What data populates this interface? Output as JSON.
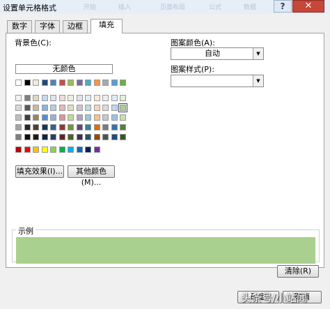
{
  "window": {
    "title": "设置单元格格式",
    "ghost_menu": [
      "开始",
      "插入",
      "页面布局",
      "公式",
      "数据"
    ],
    "help_label": "?",
    "close_label": "✕"
  },
  "tabs": [
    {
      "label": "数字",
      "active": false
    },
    {
      "label": "字体",
      "active": false
    },
    {
      "label": "边框",
      "active": false
    },
    {
      "label": "填充",
      "active": true
    }
  ],
  "fill": {
    "bg_color_label": "背景色(C):",
    "no_color_label": "无颜色",
    "palette_top": [
      "#ffffff",
      "#000000",
      "#eeece1",
      "#1f497d",
      "#4f81bd",
      "#c0504d",
      "#9bbb59",
      "#8064a2",
      "#4bacc6",
      "#f79646",
      "#aaaaaa",
      "#5b9bd5",
      "#70ad47"
    ],
    "palette_grid": [
      [
        "#f2f2f2",
        "#7f7f7f",
        "#ddd9c3",
        "#c6d9f0",
        "#dbe5f1",
        "#f2dcdb",
        "#ebf1dd",
        "#e5e0ec",
        "#dbeef3",
        "#fdeada",
        "#ededed",
        "#deebf6",
        "#e2efd9"
      ],
      [
        "#d8d8d8",
        "#595959",
        "#c4bd97",
        "#8db3e2",
        "#b8cce4",
        "#e5b9b7",
        "#d7e3bc",
        "#ccc1d9",
        "#b7dde8",
        "#fbd5b5",
        "#dbdbdb",
        "#bdd7ee",
        "#a9d08e"
      ],
      [
        "#bfbfbf",
        "#3f3f3f",
        "#938953",
        "#548dd4",
        "#95b3d7",
        "#d99694",
        "#c3d69b",
        "#b2a2c7",
        "#92cddc",
        "#fac08f",
        "#c9c9c9",
        "#9cc3e5",
        "#c5e0b3"
      ],
      [
        "#a5a5a5",
        "#262626",
        "#494429",
        "#17365d",
        "#366092",
        "#953734",
        "#76923c",
        "#5f497a",
        "#31859b",
        "#e36c09",
        "#7b7b7b",
        "#2e75b5",
        "#538135"
      ],
      [
        "#7f7f7f",
        "#0c0c0c",
        "#1d1b10",
        "#0f243e",
        "#244061",
        "#632423",
        "#4f6128",
        "#3f3151",
        "#205867",
        "#974806",
        "#525252",
        "#1f4e79",
        "#375623"
      ]
    ],
    "palette_standard": [
      "#c00000",
      "#ff0000",
      "#ffc000",
      "#ffff00",
      "#92d050",
      "#00b050",
      "#00b0f0",
      "#0070c0",
      "#002060",
      "#7030a0"
    ],
    "selected_color": "#a9d08e",
    "fill_effects_button": "填充效果(I)...",
    "more_colors_button": "其他颜色(M)...",
    "pattern_color_label": "图案颜色(A):",
    "pattern_color_value": "自动",
    "pattern_style_label": "图案样式(P):",
    "pattern_style_value": "",
    "sample_label": "示例",
    "sample_color": "#a9d08e",
    "clear_button": "清除(R)"
  },
  "footer": {
    "ok_button": "确定",
    "cancel_button": "取消"
  },
  "watermark": "头条号/小站闻"
}
